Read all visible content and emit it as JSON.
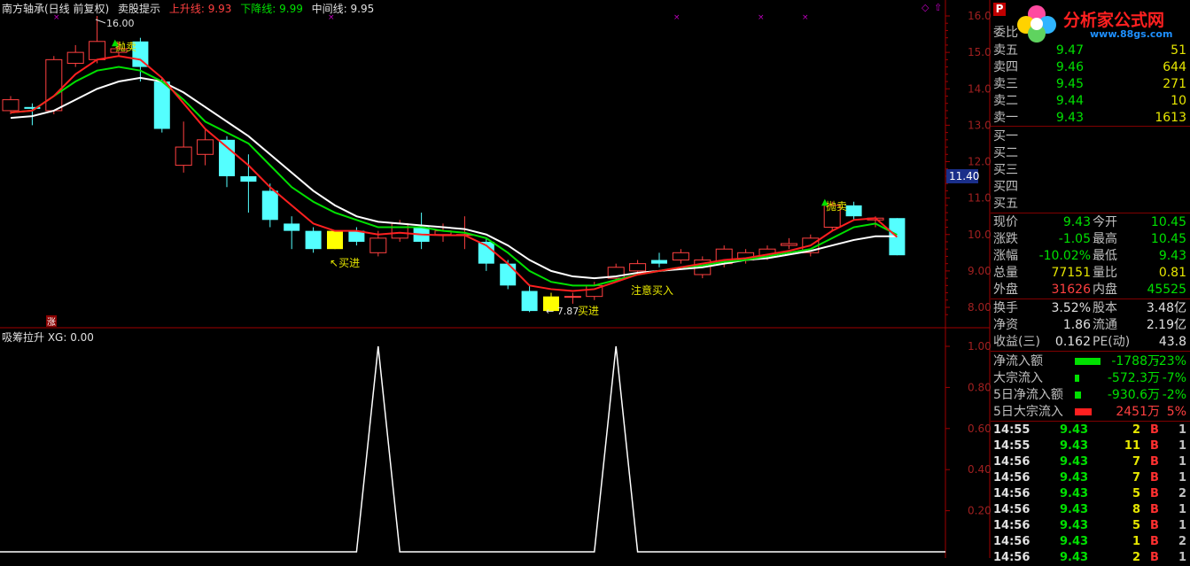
{
  "header": {
    "stock_name": "南方轴承(日线 前复权)",
    "indicator_name": "卖股提示",
    "up_line_label": "上升线: 9.93",
    "down_line_label": "下降线: 9.99",
    "mid_line_label": "中间线: 9.95"
  },
  "indicator_panel": {
    "title": "吸筹拉升 XG: 0.00"
  },
  "price_axis": {
    "ticks": [
      "16.00",
      "15.00",
      "14.00",
      "13.00",
      "12.00",
      "11.00",
      "10.00",
      "9.00",
      "8.00"
    ],
    "cursor_price": "11.40"
  },
  "ind_axis": {
    "ticks": [
      "1.00",
      "0.80",
      "0.60",
      "0.40",
      "0.20"
    ]
  },
  "annotations": {
    "high_label": "16.00",
    "low_label": "7.87",
    "sell1": "抛卖",
    "sell2": "抛卖",
    "buy1": "买进",
    "buy2": "买进",
    "attention": "注意买入",
    "zhang_badge": "涨"
  },
  "chart_data": {
    "type": "candlestick",
    "ylim": [
      7.5,
      16.4
    ],
    "candles": [
      {
        "o": 13.4,
        "c": 13.7,
        "h": 13.8,
        "l": 13.3
      },
      {
        "o": 13.5,
        "c": 13.45,
        "h": 13.6,
        "l": 13.0
      },
      {
        "o": 13.4,
        "c": 14.8,
        "h": 14.9,
        "l": 13.3
      },
      {
        "o": 14.7,
        "c": 15.0,
        "h": 15.2,
        "l": 14.6
      },
      {
        "o": 14.8,
        "c": 15.3,
        "h": 16.0,
        "l": 14.7
      },
      {
        "o": 15.0,
        "c": 15.1,
        "h": 15.3,
        "l": 14.9
      },
      {
        "o": 15.3,
        "c": 14.6,
        "h": 15.4,
        "l": 14.2
      },
      {
        "o": 14.2,
        "c": 12.9,
        "h": 14.3,
        "l": 12.8
      },
      {
        "o": 11.9,
        "c": 12.4,
        "h": 13.1,
        "l": 11.7
      },
      {
        "o": 12.2,
        "c": 12.6,
        "h": 12.9,
        "l": 11.9
      },
      {
        "o": 12.6,
        "c": 11.6,
        "h": 12.7,
        "l": 11.3
      },
      {
        "o": 11.6,
        "c": 11.45,
        "h": 12.2,
        "l": 10.6
      },
      {
        "o": 11.2,
        "c": 10.4,
        "h": 11.4,
        "l": 10.2
      },
      {
        "o": 10.3,
        "c": 10.1,
        "h": 10.5,
        "l": 9.6
      },
      {
        "o": 10.1,
        "c": 9.6,
        "h": 10.2,
        "l": 9.5
      },
      {
        "o": 9.6,
        "c": 10.1,
        "h": 10.1,
        "l": 9.6
      },
      {
        "o": 10.1,
        "c": 9.8,
        "h": 10.2,
        "l": 9.7
      },
      {
        "o": 9.5,
        "c": 9.9,
        "h": 10.1,
        "l": 9.4
      },
      {
        "o": 9.9,
        "c": 10.3,
        "h": 10.4,
        "l": 9.8
      },
      {
        "o": 10.2,
        "c": 9.8,
        "h": 10.6,
        "l": 9.6
      },
      {
        "o": 10.0,
        "c": 10.1,
        "h": 10.3,
        "l": 9.8
      },
      {
        "o": 10.0,
        "c": 10.0,
        "h": 10.5,
        "l": 9.6
      },
      {
        "o": 9.8,
        "c": 9.2,
        "h": 9.9,
        "l": 9.0
      },
      {
        "o": 9.2,
        "c": 8.6,
        "h": 9.3,
        "l": 8.5
      },
      {
        "o": 8.45,
        "c": 7.9,
        "h": 8.6,
        "l": 7.87
      },
      {
        "o": 7.9,
        "c": 8.3,
        "h": 8.4,
        "l": 7.9
      },
      {
        "o": 8.3,
        "c": 8.3,
        "h": 8.4,
        "l": 8.1
      },
      {
        "o": 8.3,
        "c": 8.6,
        "h": 8.7,
        "l": 8.2
      },
      {
        "o": 8.8,
        "c": 9.1,
        "h": 9.2,
        "l": 8.7
      },
      {
        "o": 9.0,
        "c": 9.2,
        "h": 9.3,
        "l": 8.9
      },
      {
        "o": 9.3,
        "c": 9.2,
        "h": 9.5,
        "l": 9.1
      },
      {
        "o": 9.3,
        "c": 9.5,
        "h": 9.6,
        "l": 9.2
      },
      {
        "o": 8.9,
        "c": 9.3,
        "h": 9.4,
        "l": 8.8
      },
      {
        "o": 9.2,
        "c": 9.6,
        "h": 9.7,
        "l": 9.1
      },
      {
        "o": 9.3,
        "c": 9.5,
        "h": 9.6,
        "l": 9.2
      },
      {
        "o": 9.4,
        "c": 9.6,
        "h": 9.7,
        "l": 9.3
      },
      {
        "o": 9.7,
        "c": 9.75,
        "h": 9.9,
        "l": 9.6
      },
      {
        "o": 9.5,
        "c": 9.9,
        "h": 10.0,
        "l": 9.4
      },
      {
        "o": 10.2,
        "c": 10.8,
        "h": 10.9,
        "l": 10.1
      },
      {
        "o": 10.8,
        "c": 10.5,
        "h": 10.9,
        "l": 10.4
      },
      {
        "o": 10.4,
        "c": 10.45,
        "h": 10.5,
        "l": 10.2
      },
      {
        "o": 10.45,
        "c": 9.43,
        "h": 10.45,
        "l": 9.43
      }
    ],
    "up_line": [
      13.35,
      13.4,
      13.8,
      14.4,
      14.8,
      14.9,
      14.8,
      14.3,
      13.6,
      12.9,
      12.4,
      11.9,
      11.3,
      10.8,
      10.3,
      10.1,
      10.1,
      10.0,
      10.05,
      10.0,
      9.98,
      9.98,
      9.7,
      9.2,
      8.6,
      8.5,
      8.45,
      8.5,
      8.7,
      8.9,
      9.0,
      9.1,
      9.2,
      9.3,
      9.35,
      9.45,
      9.55,
      9.7,
      10.1,
      10.4,
      10.45,
      9.93
    ],
    "down_line": [
      13.35,
      13.4,
      13.8,
      14.2,
      14.5,
      14.6,
      14.5,
      14.2,
      13.7,
      13.1,
      12.8,
      12.5,
      11.9,
      11.3,
      10.9,
      10.6,
      10.4,
      10.2,
      10.2,
      10.2,
      10.1,
      10.05,
      9.9,
      9.5,
      9.0,
      8.7,
      8.6,
      8.6,
      8.75,
      8.9,
      9.0,
      9.1,
      9.15,
      9.25,
      9.3,
      9.4,
      9.5,
      9.6,
      9.9,
      10.2,
      10.3,
      9.99
    ],
    "mid_line": [
      13.2,
      13.25,
      13.4,
      13.7,
      14.0,
      14.2,
      14.3,
      14.2,
      13.9,
      13.5,
      13.1,
      12.7,
      12.2,
      11.7,
      11.2,
      10.8,
      10.5,
      10.35,
      10.3,
      10.25,
      10.2,
      10.15,
      10.0,
      9.7,
      9.3,
      9.0,
      8.85,
      8.8,
      8.85,
      8.95,
      9.0,
      9.05,
      9.1,
      9.2,
      9.3,
      9.35,
      9.45,
      9.55,
      9.7,
      9.85,
      9.95,
      9.95
    ],
    "indicator": {
      "ylim": [
        0,
        1.05
      ],
      "values_spike_idx": [
        17,
        28
      ],
      "spike_value": 1.0
    }
  },
  "quote_panel": {
    "badge": "P",
    "logo_text": "分析家公式网",
    "logo_url": "www.88gs.com",
    "weibi_label": "委比",
    "asks": [
      {
        "label": "卖五",
        "price": "9.47",
        "vol": "51"
      },
      {
        "label": "卖四",
        "price": "9.46",
        "vol": "644"
      },
      {
        "label": "卖三",
        "price": "9.45",
        "vol": "271"
      },
      {
        "label": "卖二",
        "price": "9.44",
        "vol": "10"
      },
      {
        "label": "卖一",
        "price": "9.43",
        "vol": "1613"
      }
    ],
    "bids": [
      {
        "label": "买一"
      },
      {
        "label": "买二"
      },
      {
        "label": "买三"
      },
      {
        "label": "买四"
      },
      {
        "label": "买五"
      }
    ],
    "stats": [
      {
        "l1": "现价",
        "v1": "9.43",
        "l2": "今开",
        "v2": "10.45"
      },
      {
        "l1": "涨跌",
        "v1": "-1.05",
        "l2": "最高",
        "v2": "10.45"
      },
      {
        "l1": "涨幅",
        "v1": "-10.02%",
        "l2": "最低",
        "v2": "9.43"
      },
      {
        "l1": "总量",
        "v1": "77151",
        "l2": "量比",
        "v2": "0.81"
      },
      {
        "l1": "外盘",
        "v1": "31626",
        "l2": "内盘",
        "v2": "45525"
      }
    ],
    "stats2": [
      {
        "l1": "换手",
        "v1": "3.52%",
        "l2": "股本",
        "v2": "3.48亿"
      },
      {
        "l1": "净资",
        "v1": "1.86",
        "l2": "流通",
        "v2": "2.19亿"
      },
      {
        "l1": "收益(三)",
        "v1": "0.162",
        "l2": "PE(动)",
        "v2": "43.8"
      }
    ],
    "flows": [
      {
        "label": "净流入额",
        "value": "-1788万",
        "pct": "-23%",
        "bar": "green",
        "bar_fraction": 0.24
      },
      {
        "label": "大宗流入",
        "value": "-572.3万",
        "pct": "-7%",
        "bar": "green",
        "bar_fraction": 0.04
      },
      {
        "label": "5日净流入额",
        "value": "-930.6万",
        "pct": "-2%",
        "bar": "green",
        "bar_fraction": 0.06
      },
      {
        "label": "5日大宗流入",
        "value": "2451万",
        "pct": "5%",
        "bar": "red",
        "bar_fraction": 0.16
      }
    ],
    "trades": [
      {
        "time": "14:55",
        "price": "9.43",
        "vol": "2",
        "bs": "B",
        "n": "1"
      },
      {
        "time": "14:55",
        "price": "9.43",
        "vol": "11",
        "bs": "B",
        "n": "1"
      },
      {
        "time": "14:56",
        "price": "9.43",
        "vol": "7",
        "bs": "B",
        "n": "1"
      },
      {
        "time": "14:56",
        "price": "9.43",
        "vol": "7",
        "bs": "B",
        "n": "1"
      },
      {
        "time": "14:56",
        "price": "9.43",
        "vol": "5",
        "bs": "B",
        "n": "2"
      },
      {
        "time": "14:56",
        "price": "9.43",
        "vol": "8",
        "bs": "B",
        "n": "1"
      },
      {
        "time": "14:56",
        "price": "9.43",
        "vol": "5",
        "bs": "B",
        "n": "1"
      },
      {
        "time": "14:56",
        "price": "9.43",
        "vol": "1",
        "bs": "B",
        "n": "2"
      },
      {
        "time": "14:56",
        "price": "9.43",
        "vol": "2",
        "bs": "B",
        "n": "1"
      }
    ]
  }
}
